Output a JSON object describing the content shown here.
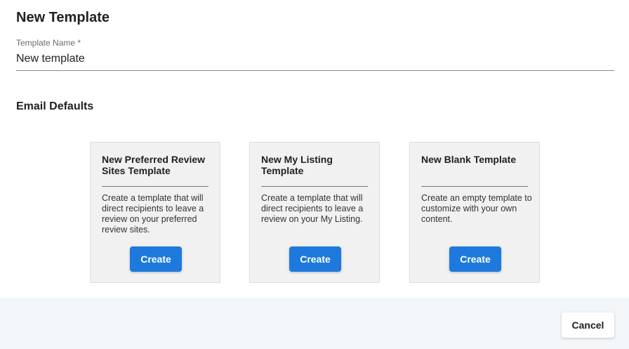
{
  "dialog": {
    "title": "New Template"
  },
  "template_name": {
    "label": "Template Name *",
    "value": "New template"
  },
  "email_defaults": {
    "title": "Email Defaults"
  },
  "cards": [
    {
      "title": "New Preferred Review Sites Template",
      "description": "Create a template that will direct recipients to leave a review on your preferred review sites.",
      "button_label": "Create"
    },
    {
      "title": "New My Listing Template",
      "description": "Create a template that will direct recipients to leave a review on your My Listing.",
      "button_label": "Create"
    },
    {
      "title": "New Blank Template",
      "description": "Create an empty template to customize with your own content.",
      "button_label": "Create"
    }
  ],
  "footer": {
    "cancel_label": "Cancel"
  },
  "colors": {
    "primary_button": "#1e79dd",
    "card_background": "#f1f1f1",
    "footer_background": "#f2f6f9"
  }
}
